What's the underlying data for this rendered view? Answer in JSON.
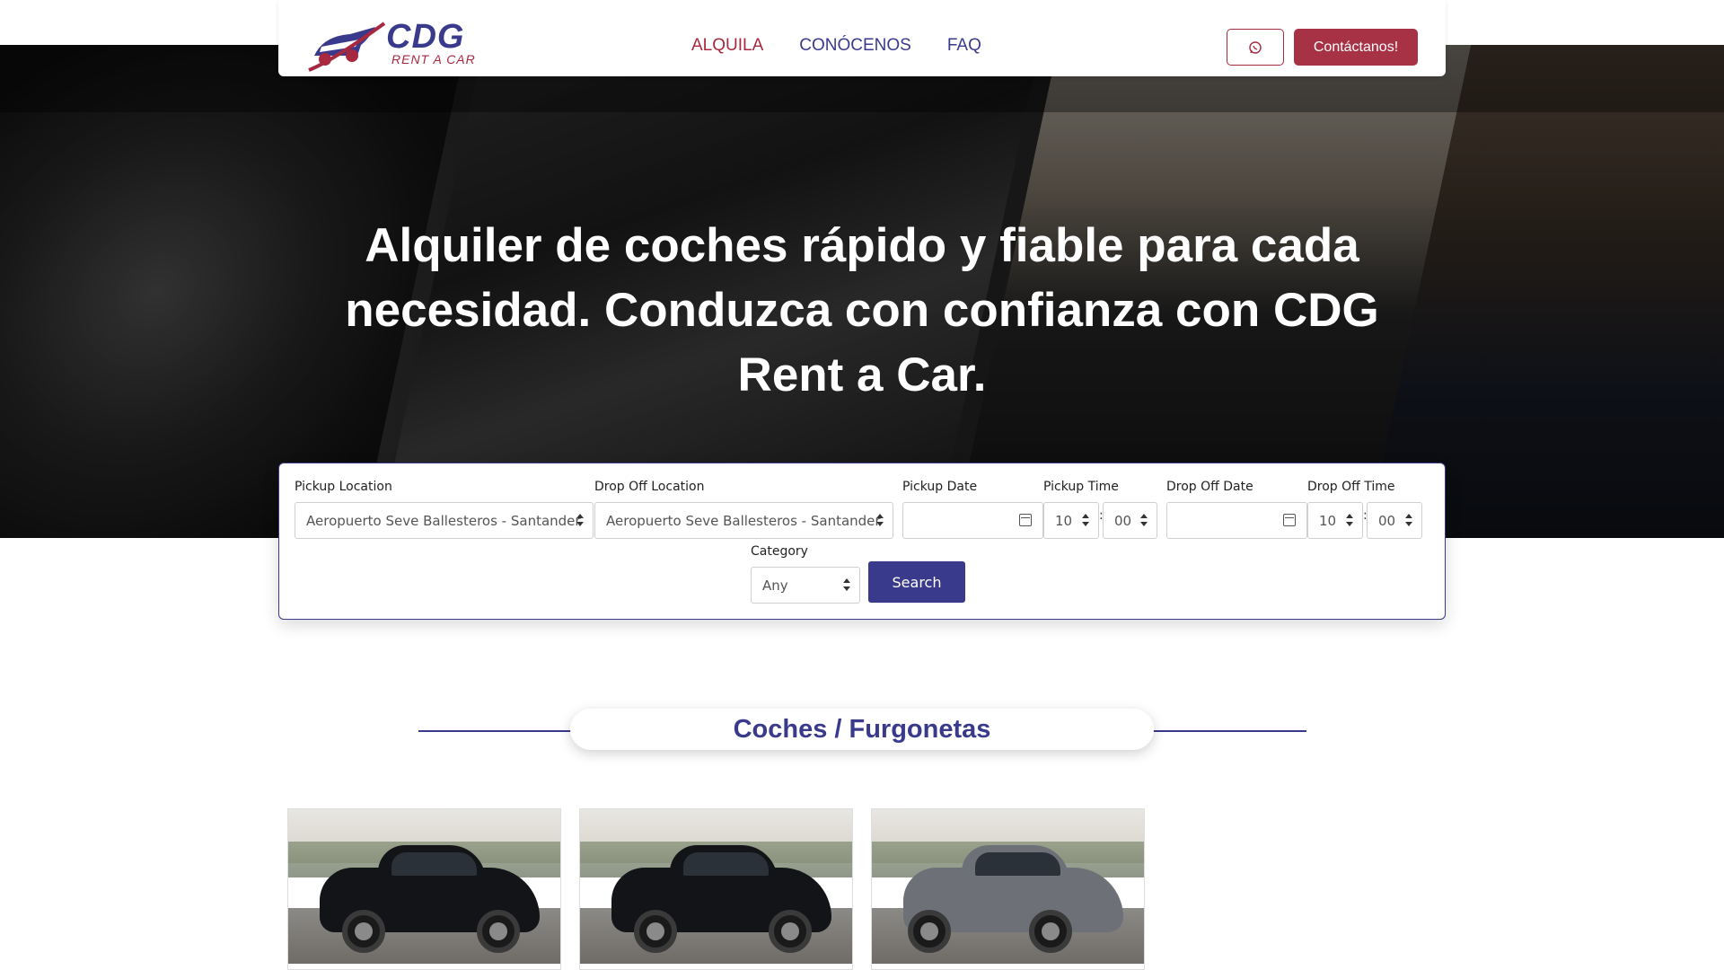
{
  "header": {
    "logo": {
      "brand": "CDG",
      "tagline": "RENT A CAR"
    },
    "nav": [
      {
        "label": "ALQUILA",
        "active": true
      },
      {
        "label": "CONÓCENOS",
        "active": false
      },
      {
        "label": "FAQ",
        "active": false
      }
    ],
    "whatsapp_icon": "whatsapp-icon",
    "contact_label": "Contáctanos!"
  },
  "hero": {
    "title": "Alquiler de coches rápido y fiable para cada necesidad. Conduzca con confianza con CDG Rent a Car."
  },
  "search": {
    "pickup_location_label": "Pickup Location",
    "pickup_location_value": "Aeropuerto Seve Ballesteros - Santander",
    "dropoff_location_label": "Drop Off Location",
    "dropoff_location_value": "Aeropuerto Seve Ballesteros - Santander",
    "pickup_date_label": "Pickup Date",
    "pickup_date_value": "",
    "pickup_time_label": "Pickup Time",
    "pickup_hour": "10",
    "pickup_minute": "00",
    "dropoff_date_label": "Drop Off Date",
    "dropoff_date_value": "",
    "dropoff_time_label": "Drop Off Time",
    "dropoff_hour": "10",
    "dropoff_minute": "00",
    "time_separator": ":",
    "category_label": "Category",
    "category_value": "Any",
    "search_label": "Search"
  },
  "section": {
    "title": "Coches / Furgonetas"
  },
  "cars": [
    {
      "color": "#121418"
    },
    {
      "color": "#121418"
    },
    {
      "color": "#6d7177"
    }
  ],
  "colors": {
    "brand_blue": "#3a3a8c",
    "brand_red": "#a83245"
  }
}
